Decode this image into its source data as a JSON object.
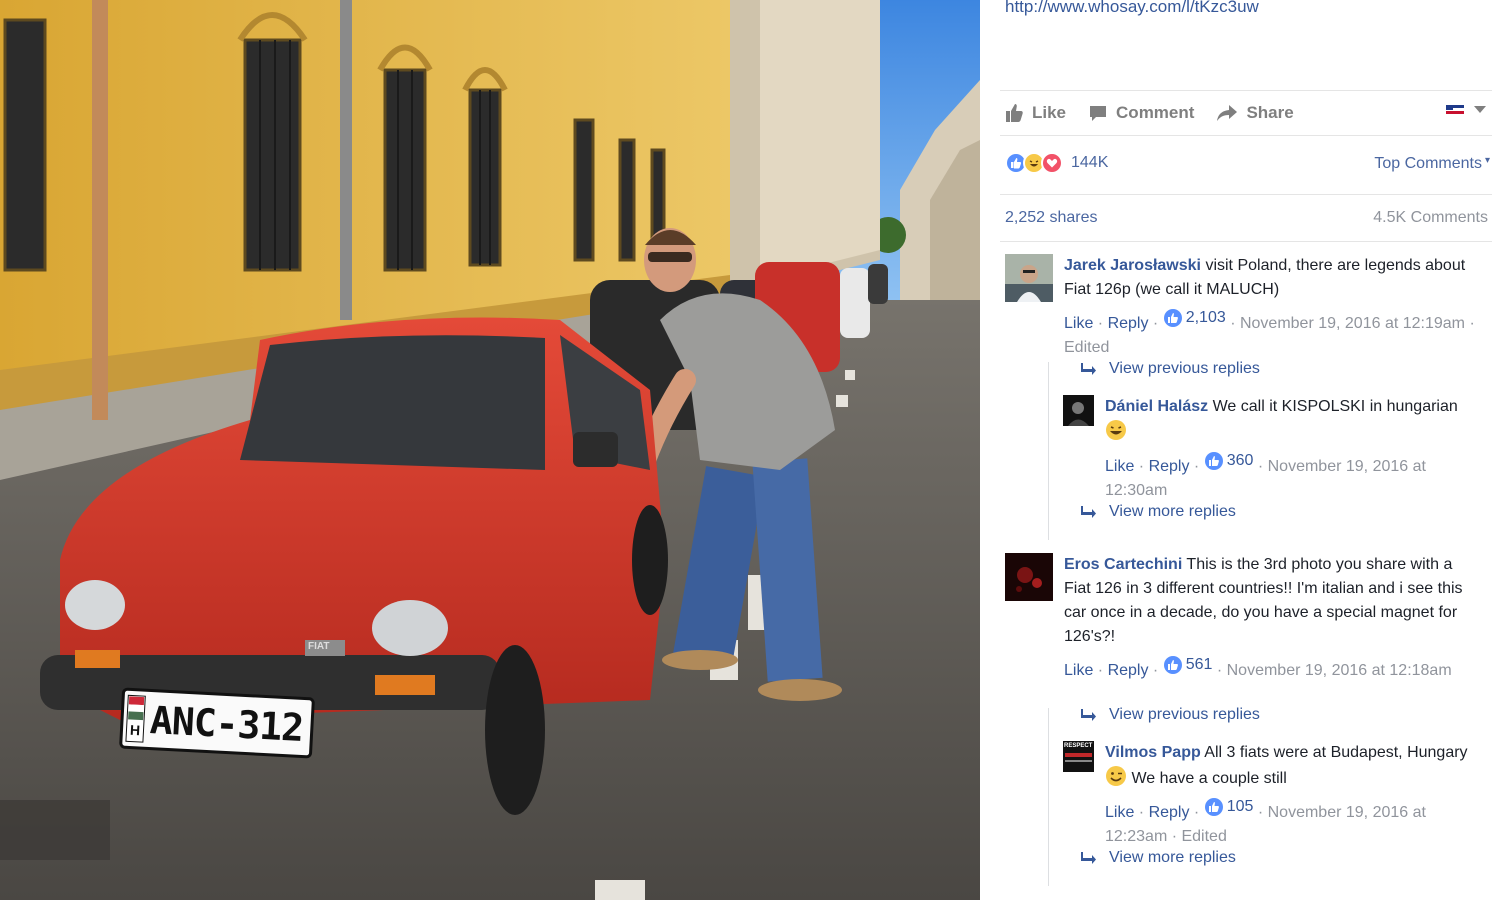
{
  "photo": {
    "alt_subject": "man-with-red-fiat",
    "plate_country": "H",
    "plate_text": "ANC-312",
    "car_badge": "FIAT"
  },
  "post": {
    "link_text": "http://www.whosay.com/l/tKzc3uw",
    "actions": {
      "like": "Like",
      "comment": "Comment",
      "share": "Share"
    },
    "reaction_count": "144K",
    "top_comments": "Top Comments",
    "shares": "2,252 shares",
    "comments_count": "4.5K Comments"
  },
  "comments": [
    {
      "author": "Jarek Jarosławski",
      "text": " visit Poland, there are legends about Fiat 126p (we call it MALUCH)",
      "like": "Like",
      "reply": "Reply",
      "likes": "2,103",
      "date": "November 19, 2016 at 12:19am",
      "edited": "Edited",
      "view_previous": "View previous replies",
      "reply_item": {
        "author": "Dániel Halász",
        "text": " We call it KISPOLSKI in hungarian ",
        "like": "Like",
        "reply": "Reply",
        "likes": "360",
        "date": "November 19, 2016 at 12:30am"
      },
      "view_more": "View more replies"
    },
    {
      "author": "Eros Cartechini",
      "text": " This is the 3rd photo you share with a Fiat 126 in 3 different countries!! I'm italian and i see this car once in a decade, do you have a special magnet for 126's?!",
      "like": "Like",
      "reply": "Reply",
      "likes": "561",
      "date": "November 19, 2016 at 12:18am",
      "view_previous": "View previous replies",
      "reply_item": {
        "author": "Vilmos Papp",
        "text_a": " All 3 fiats were at Budapest, Hungary ",
        "text_b": " We have a couple still",
        "avatar_text": "RESPECT",
        "like": "Like",
        "reply": "Reply",
        "likes": "105",
        "date": "November 19, 2016 at 12:23am",
        "edited": "Edited"
      },
      "view_more": "View more replies"
    }
  ],
  "colors": {
    "link": "#365899",
    "muted": "#90949c",
    "like_blue": "#5890ff",
    "car_red": "#d63a2b",
    "building_yellow": "#e3b547"
  }
}
